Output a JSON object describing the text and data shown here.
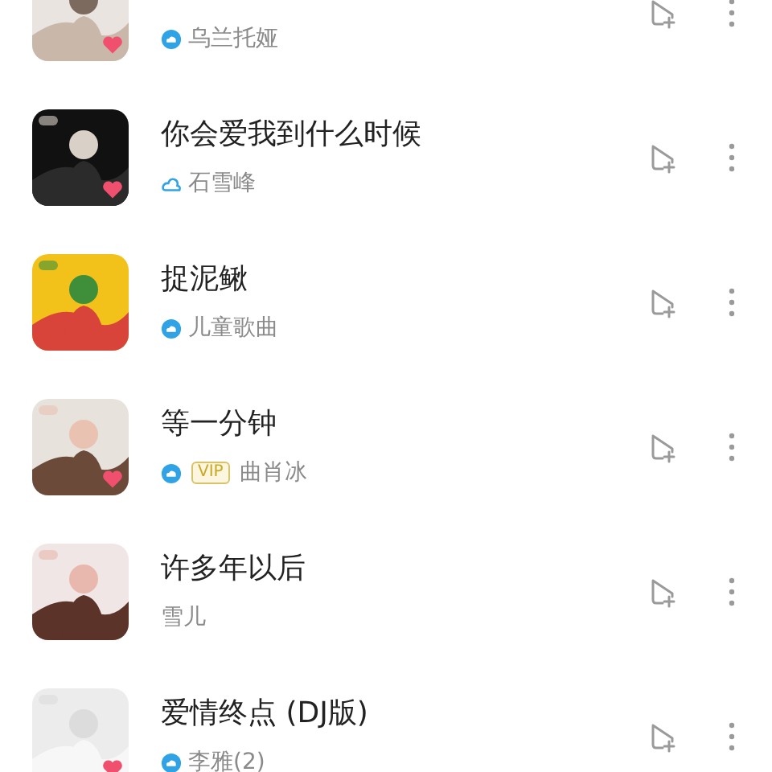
{
  "songs": [
    {
      "artist": "乌兰托娅",
      "cloud_icon": true,
      "cloud_filled": true,
      "vip": false,
      "heart": true
    },
    {
      "title": "你会爱我到什么时候",
      "artist": "石雪峰",
      "cloud_icon": true,
      "cloud_filled": false,
      "vip": false,
      "heart": true
    },
    {
      "title": "捉泥鳅",
      "artist": "儿童歌曲",
      "cloud_icon": true,
      "cloud_filled": true,
      "vip": false,
      "heart": false
    },
    {
      "title": "等一分钟",
      "artist": "曲肖冰",
      "cloud_icon": true,
      "cloud_filled": true,
      "vip": true,
      "vip_label": "VIP",
      "heart": true
    },
    {
      "title": "许多年以后",
      "artist": "雪儿",
      "cloud_icon": false,
      "vip": false,
      "heart": false
    },
    {
      "title": "爱情终点 (DJ版)",
      "artist": "李雅(2)",
      "cloud_icon": true,
      "cloud_filled": true,
      "vip": false,
      "heart": true
    }
  ]
}
